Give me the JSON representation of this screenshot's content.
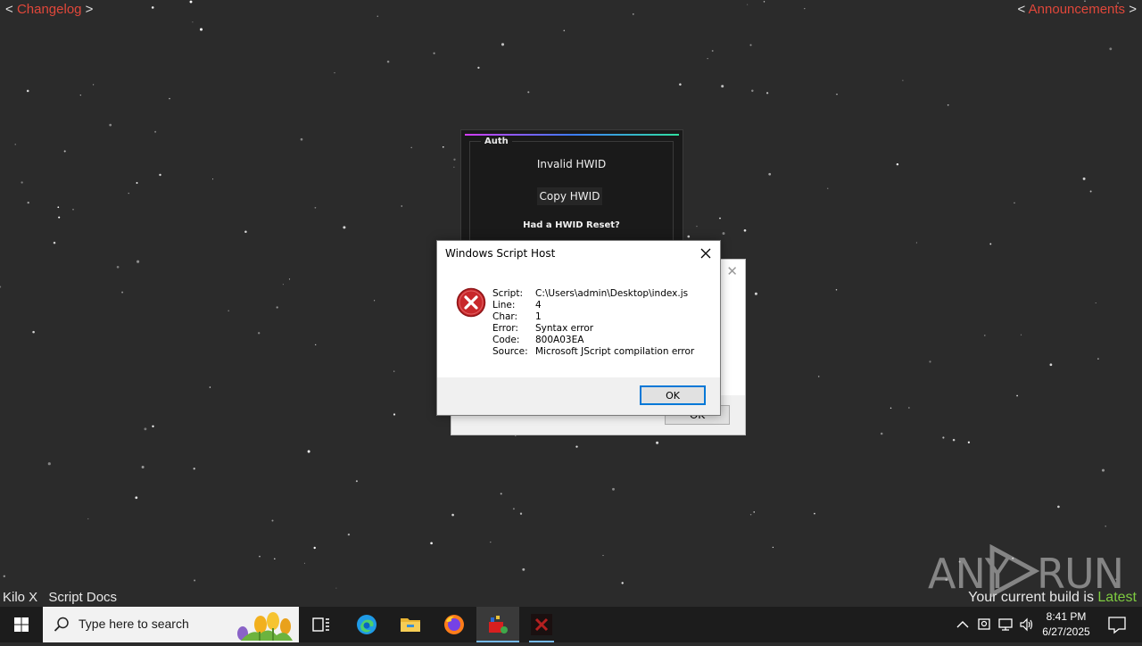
{
  "top_links": {
    "left_open": "<",
    "left_label": "Changelog",
    "left_close": ">",
    "right_open": "<",
    "right_label": "Announcements",
    "right_close": ">"
  },
  "bottom": {
    "left_items": [
      "Kilo X",
      "Script Docs"
    ],
    "build_prefix": "Your current build is",
    "build_status": "Latest"
  },
  "watermark": {
    "text_a": "ANY",
    "text_b": "RUN"
  },
  "auth_window": {
    "group_label": "Auth",
    "status": "Invalid HWID",
    "copy_button": "Copy HWID",
    "reset_text": "Had a HWID Reset?"
  },
  "background_dialog": {
    "ok_label": "OK"
  },
  "wsh_dialog": {
    "title": "Windows Script Host",
    "fields": [
      {
        "key": "Script:",
        "value": "C:\\Users\\admin\\Desktop\\index.js"
      },
      {
        "key": "Line:",
        "value": "4"
      },
      {
        "key": "Char:",
        "value": "1"
      },
      {
        "key": "Error:",
        "value": "Syntax error"
      },
      {
        "key": "Code:",
        "value": "800A03EA"
      },
      {
        "key": "Source:",
        "value": "Microsoft JScript compilation error"
      }
    ],
    "ok_label": "OK"
  },
  "taskbar": {
    "search_placeholder": "Type here to search",
    "apps": [
      "task-view",
      "edge",
      "file-explorer",
      "firefox",
      "app-red",
      "app-dark"
    ],
    "clock_time": "8:41 PM",
    "clock_date": "6/27/2025"
  },
  "colors": {
    "link_red": "#e0473a",
    "latest_green": "#7ecb40",
    "taskbar_bg": "#1c1c1c",
    "desktop_bg": "#2b2b2b"
  }
}
